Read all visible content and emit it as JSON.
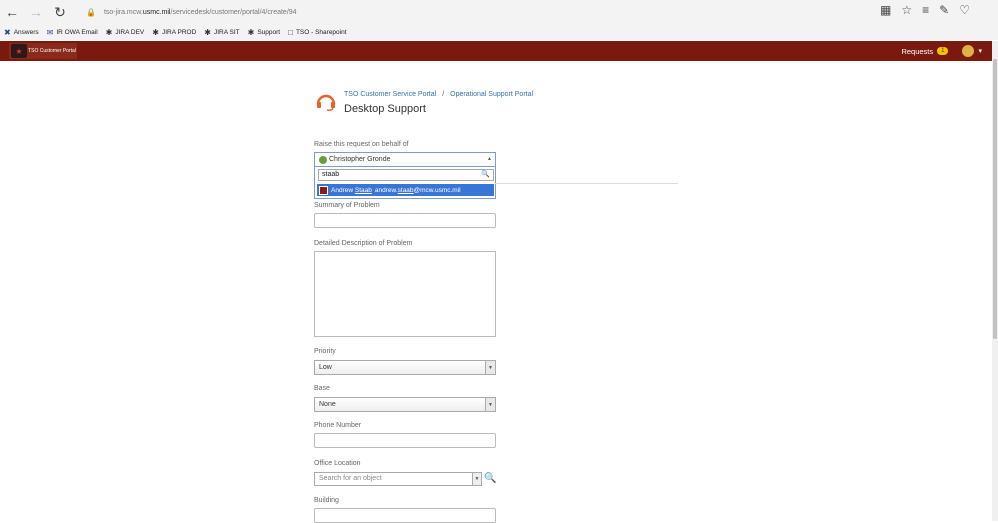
{
  "browser": {
    "url_prefix": "tso-jira.mcw.",
    "url_host": "usmc.mil",
    "url_path": "/servicedesk/customer/portal/4/create/94",
    "bookmarks": [
      {
        "label": "Answers",
        "icon": "answers-icon"
      },
      {
        "label": "IR OWA Email",
        "icon": "outlook-icon"
      },
      {
        "label": "JIRA DEV",
        "icon": "jira-icon"
      },
      {
        "label": "JIRA PROD",
        "icon": "jira-icon"
      },
      {
        "label": "JIRA SIT",
        "icon": "jira-icon"
      },
      {
        "label": "Support",
        "icon": "jira-icon"
      },
      {
        "label": "TSO - Sharepoint",
        "icon": "page-icon"
      }
    ]
  },
  "header": {
    "logo_text": "TSO Customer Portal",
    "requests_label": "Requests",
    "requests_count": "1",
    "brand_color": "#7a1a0e"
  },
  "portal": {
    "breadcrumb_home": "TSO Customer Service Portal",
    "breadcrumb_sep": "/",
    "breadcrumb_portal": "Operational Support Portal",
    "title": "Desktop Support"
  },
  "form": {
    "behalf_label": "Raise this request on behalf of",
    "behalf_value": "Christopher Gronde",
    "search_value": "staab",
    "result_name_pre": "Andrew ",
    "result_name_hl": "Staab",
    "result_email_pre": "andrew.",
    "result_email_hl": "staab",
    "result_email_post": "@mcw.usmc.mil",
    "summary_label": "Summary of Problem",
    "description_label": "Detailed Description of Problem",
    "priority_label": "Priority",
    "priority_value": "Low",
    "base_label": "Base",
    "base_value": "None",
    "phone_label": "Phone Number",
    "office_label": "Office Location",
    "office_placeholder": "Search for an object",
    "building_label": "Building"
  }
}
